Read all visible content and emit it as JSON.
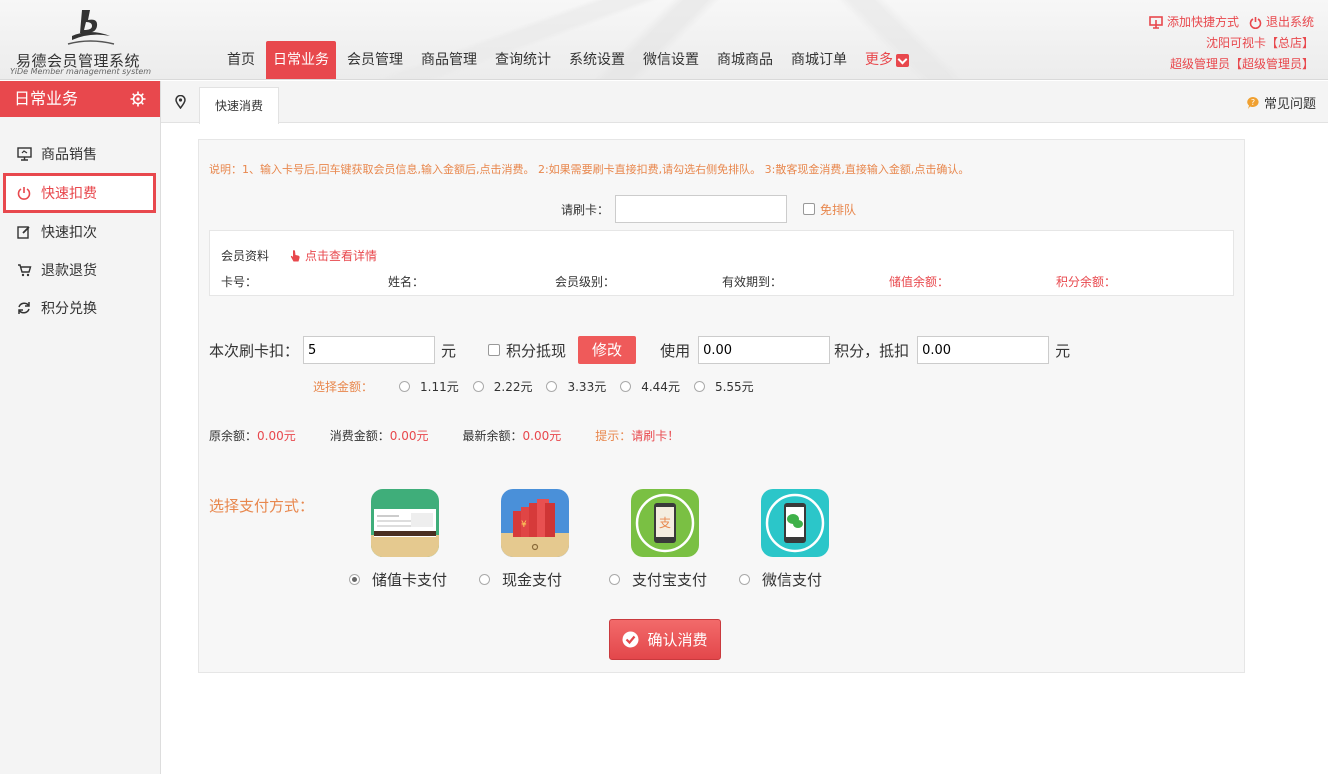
{
  "app": {
    "logo_name": "易德会员管理系统",
    "logo_sub": "YiDe Member management system"
  },
  "nav": {
    "items": [
      "首页",
      "日常业务",
      "会员管理",
      "商品管理",
      "查询统计",
      "系统设置",
      "微信设置",
      "商城商品",
      "商城订单"
    ],
    "more": "更多",
    "active_index": 1
  },
  "topright": {
    "add_shortcut": "添加快捷方式",
    "logout": "退出系统",
    "store": "沈阳可视卡【总店】",
    "user": "超级管理员【超级管理员】"
  },
  "sidebar": {
    "title": "日常业务",
    "items": [
      {
        "label": "商品销售",
        "icon": "monitor-icon"
      },
      {
        "label": "快速扣费",
        "icon": "power-icon"
      },
      {
        "label": "快速扣次",
        "icon": "edit-icon"
      },
      {
        "label": "退款退货",
        "icon": "cart-icon"
      },
      {
        "label": "积分兑换",
        "icon": "refresh-icon"
      }
    ],
    "active_index": 1
  },
  "tabbar": {
    "tab": "快速消费",
    "faq": "常见问题"
  },
  "form": {
    "note": "说明：1、输入卡号后,回车键获取会员信息,输入金额后,点击消费。 2:如果需要刷卡直接扣费,请勾选右侧免排队。 3:散客现金消费,直接输入金额,点击确认。",
    "card_label": "请刷卡：",
    "card_value": "",
    "skip_queue": "免排队",
    "member_title": "会员资料",
    "member_link": "点击查看详情",
    "member_fields": [
      "卡号：",
      "姓名：",
      "会员级别：",
      "有效期到：",
      "储值余额：",
      "积分余额："
    ],
    "deduct_label": "本次刷卡扣：",
    "deduct_value": "5",
    "unit_yuan": "元",
    "points_offset": "积分抵现",
    "modify_button": "修改",
    "use_label": "使用",
    "use_points": "0.00",
    "points_deduct_label": "积分，抵扣",
    "deduct_amount": "0.00",
    "unit_yuan2": "元",
    "select_amount_label": "选择金额：",
    "amounts": [
      "1.11元",
      "2.22元",
      "3.33元",
      "4.44元",
      "5.55元"
    ],
    "balance": {
      "original_label": "原余额：",
      "original_value": "0.00元",
      "consume_label": "消费金额：",
      "consume_value": "0.00元",
      "new_label": "最新余额：",
      "new_value": "0.00元",
      "tip_label": "提示：",
      "tip_value": "请刷卡！"
    },
    "pay_label": "选择支付方式：",
    "payments": [
      {
        "label": "储值卡支付",
        "icon": "stored-card-icon",
        "selected": true
      },
      {
        "label": "现金支付",
        "icon": "cash-icon",
        "selected": false
      },
      {
        "label": "支付宝支付",
        "icon": "alipay-icon",
        "selected": false
      },
      {
        "label": "微信支付",
        "icon": "wechat-icon",
        "selected": false
      }
    ],
    "confirm_button": "确认消费"
  },
  "colors": {
    "accent": "#e8484d",
    "orange": "#e8874d"
  }
}
